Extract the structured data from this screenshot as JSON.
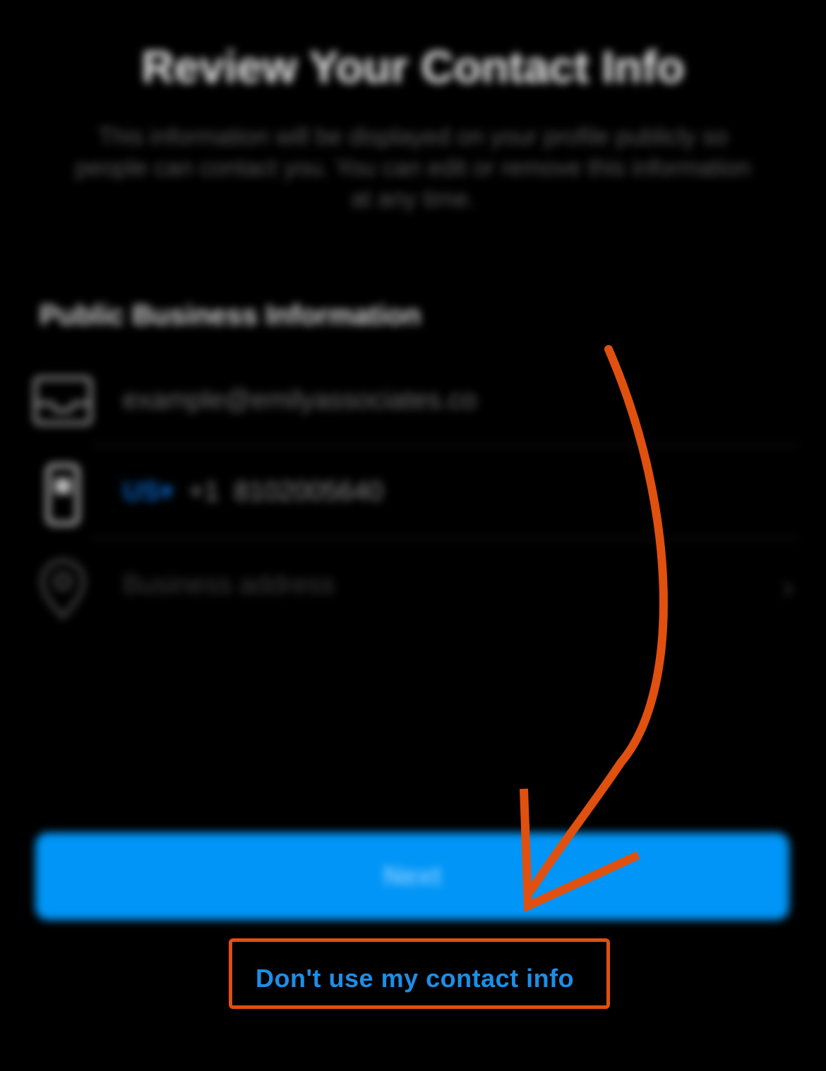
{
  "header": {
    "title": "Review Your Contact Info",
    "subtitle": "This information will be displayed on your profile publicly so people can contact you. You can edit or remove this information at any time."
  },
  "section": {
    "title": "Public Business Information"
  },
  "contact": {
    "email": {
      "value": "example@emilyassociates.co",
      "icon": "mail-icon"
    },
    "phone": {
      "country_code": "US",
      "prefix": "+1",
      "number": "8102005640",
      "icon": "phone-icon"
    },
    "address": {
      "placeholder": "Business address",
      "icon": "location-pin-icon",
      "chevron_icon": "chevron-right-icon"
    }
  },
  "actions": {
    "next_label": "Next",
    "dont_use_label": "Don't use my contact info"
  },
  "colors": {
    "background": "#000000",
    "primary_button": "#0095f6",
    "link": "#1b8fe8",
    "annotation": "#e0500f"
  }
}
